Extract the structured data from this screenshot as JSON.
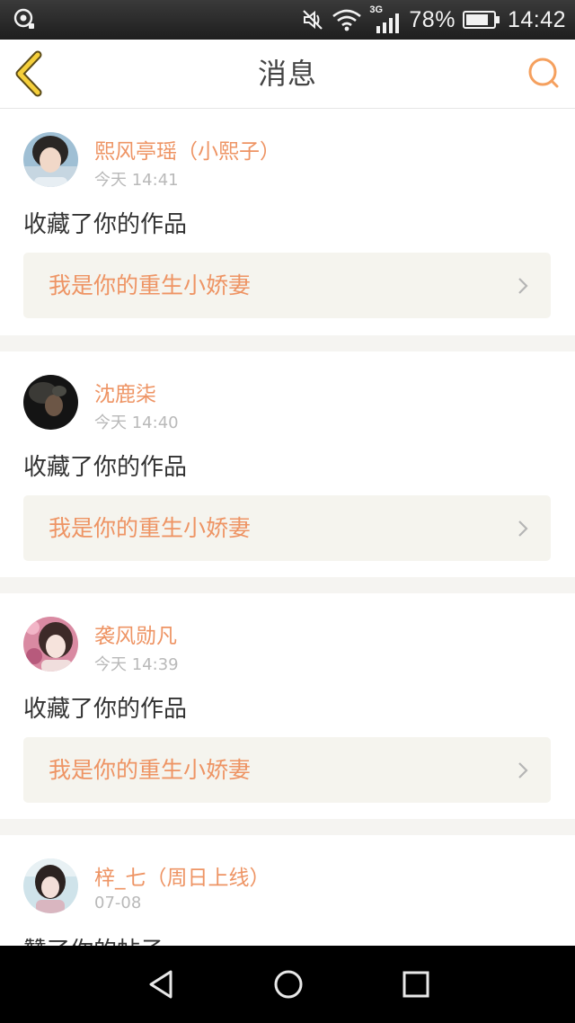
{
  "status_bar": {
    "network": "3G",
    "battery_percent": "78%",
    "time": "14:42",
    "icons": [
      "location-icon",
      "mute-icon",
      "wifi-icon",
      "signal-icon",
      "battery-icon"
    ]
  },
  "header": {
    "title": "消息",
    "back_icon": "chevron-left-icon",
    "search_icon": "search-icon",
    "accent_color": "#f5a05e"
  },
  "notifications": [
    {
      "username": "熙风亭瑶（小熙子）",
      "time": "今天 14:41",
      "action": "收藏了你的作品",
      "work_title": "我是你的重生小娇妻"
    },
    {
      "username": "沈鹿柒",
      "time": "今天 14:40",
      "action": "收藏了你的作品",
      "work_title": "我是你的重生小娇妻"
    },
    {
      "username": "袭风勋凡",
      "time": "今天 14:39",
      "action": "收藏了你的作品",
      "work_title": "我是你的重生小娇妻"
    },
    {
      "username": "梓_七（周日上线）",
      "time": "07-08",
      "action": "赞了你的帖子",
      "work_title": ""
    }
  ],
  "colors": {
    "username": "#ee9464",
    "time": "#b9b9b9",
    "card_link_bg": "#f5f4ee",
    "page_bg": "#f5f4f1"
  },
  "nav_bar": {
    "icons": [
      "back-triangle-icon",
      "home-circle-icon",
      "recents-square-icon"
    ]
  }
}
